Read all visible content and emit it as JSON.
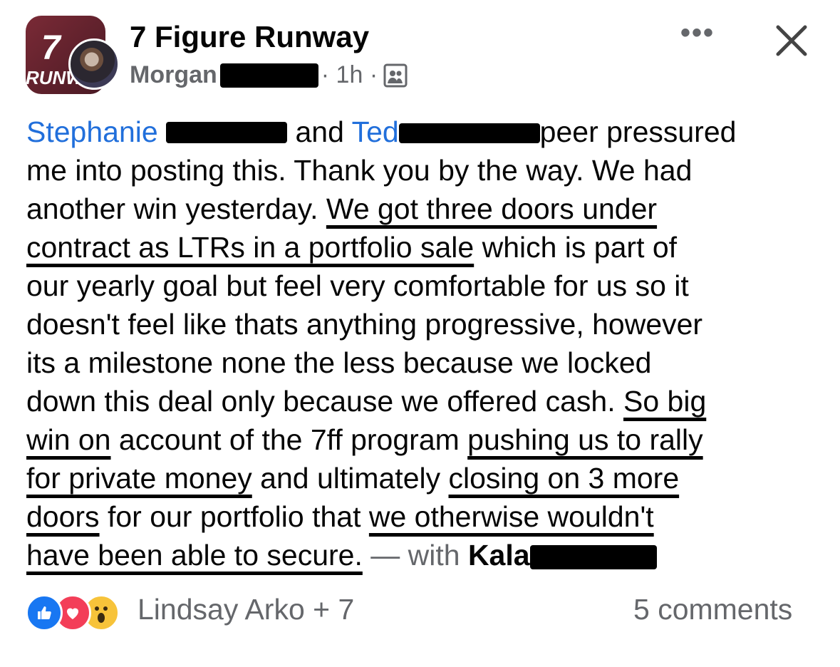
{
  "header": {
    "group_name": "7 Figure Runway",
    "logo_text_top": "7",
    "logo_text_bottom": "RUNW",
    "author_first": "Morgan",
    "time": "· 1h ·",
    "privacy_icon": "group-members-icon",
    "more_label": "•••",
    "close_icon": "close-icon"
  },
  "post": {
    "tag1": "Stephanie",
    "and": "and",
    "tag2": "Ted",
    "l1_tail": "peer pressured",
    "l2": "me into posting this. Thank you by the way. We had",
    "l3a": "another win yesterday. ",
    "l3b": "We got three doors under",
    "l4a": "contract as LTRs in a portfolio sale",
    "l4b": " which is part of",
    "l5": "our yearly goal but feel very comfortable for us so it",
    "l6": "doesn't feel like thats anything progressive, however",
    "l7": "its a milestone none the less because we locked",
    "l8a": "down this deal only because we offered cash. ",
    "l8b": "So big",
    "l9a": "win on",
    "l9b": " account of the 7ff program ",
    "l9c": "pushing us to rally",
    "l10a": "for private money",
    "l10b": " and ultimately ",
    "l10c": "closing on 3 more",
    "l11a": "doors",
    "l11b": " for our portfolio that ",
    "l11c": "we otherwise wouldn't",
    "l12a": "have been able to secure.",
    "l12b": " — with ",
    "l12c": "Kala"
  },
  "footer": {
    "reactors": "Lindsay Arko + 7",
    "comments": "5 comments",
    "reaction_icons": [
      "like-icon",
      "love-icon",
      "wow-icon"
    ]
  },
  "colors": {
    "tag_blue": "#216fdb",
    "muted_gray": "#65676b",
    "like_blue": "#1877f2",
    "love_red": "#f33e58",
    "wow_yellow": "#f7c33a"
  }
}
